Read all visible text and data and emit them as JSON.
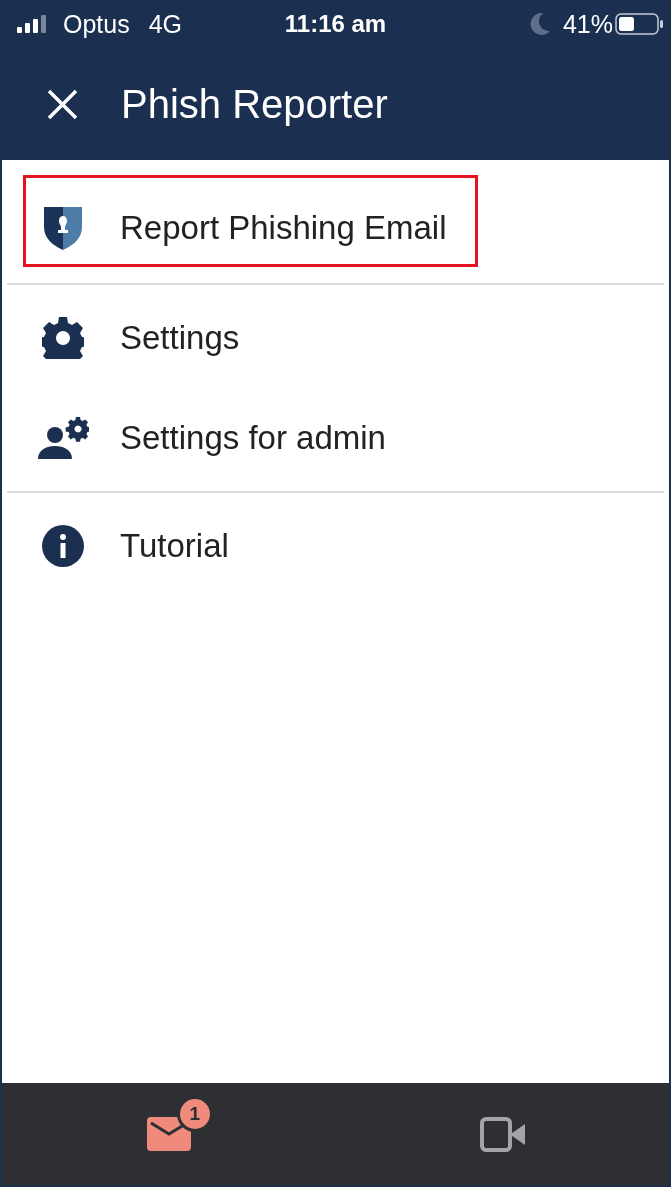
{
  "status_bar": {
    "carrier": "Optus",
    "network": "4G",
    "time": "11:16 am",
    "battery_percent": "41%"
  },
  "header": {
    "title": "Phish Reporter"
  },
  "sections": [
    {
      "items": [
        {
          "kind": "shield",
          "label": "Report Phishing Email",
          "highlighted": true
        }
      ]
    },
    {
      "items": [
        {
          "kind": "gear",
          "label": "Settings",
          "highlighted": false
        },
        {
          "kind": "user-gear",
          "label": "Settings for admin",
          "highlighted": false
        }
      ]
    },
    {
      "items": [
        {
          "kind": "info",
          "label": "Tutorial",
          "highlighted": false
        }
      ]
    }
  ],
  "tab_bar": {
    "tabs": [
      {
        "kind": "mail",
        "selected": true,
        "badge": "1"
      },
      {
        "kind": "video",
        "selected": false
      }
    ]
  }
}
